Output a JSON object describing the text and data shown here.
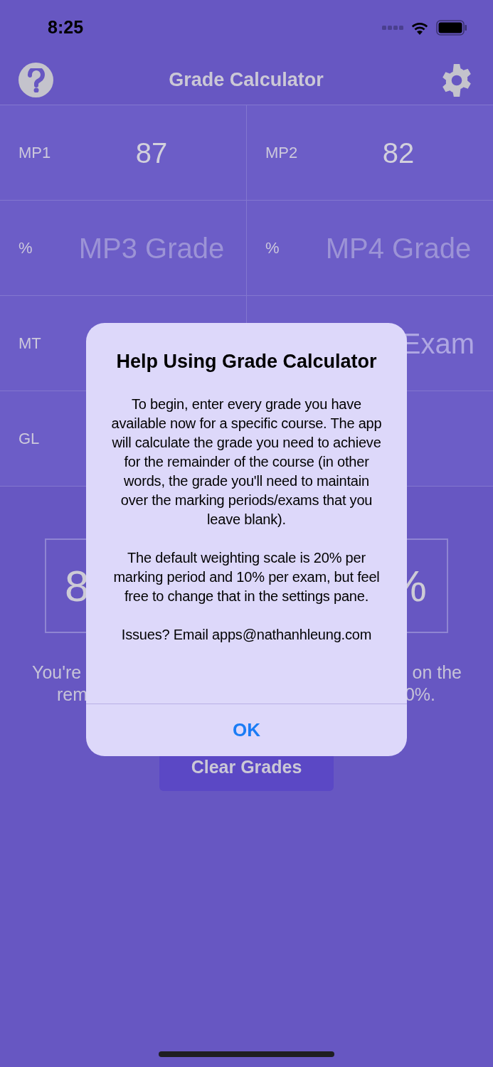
{
  "status_bar": {
    "time": "8:25"
  },
  "nav": {
    "title": "Grade Calculator"
  },
  "grade_rows": [
    {
      "left": {
        "label": "MP1",
        "value": "87"
      },
      "right": {
        "label": "MP2",
        "value": "82"
      }
    },
    {
      "left": {
        "label": "%",
        "placeholder": "MP3 Grade"
      },
      "right": {
        "label": "%",
        "placeholder": "MP4 Grade"
      }
    },
    {
      "left": {
        "label": "MT"
      },
      "right": {
        "placeholder": "Exam"
      }
    },
    {
      "left": {
        "label": "GL"
      }
    }
  ],
  "results": {
    "left_box": "8",
    "right_box": "%",
    "left_message": [
      "You're",
      "rem"
    ],
    "right_message": [
      "on the",
      "0%."
    ]
  },
  "clear_button": {
    "label": "Clear Grades"
  },
  "dialog": {
    "title": "Help Using Grade Calculator",
    "paragraphs": [
      "To begin, enter every grade you have available now for a specific course. The app will calculate the grade you need to achieve for the remainder of the course (in other words, the grade you'll need to maintain over the marking periods/exams that you leave blank).",
      "The default weighting scale is 20% per marking period and 10% per exam, but feel free to change that in the settings pane.",
      "Issues? Email apps@nathanhleung.com"
    ],
    "button": "OK"
  }
}
